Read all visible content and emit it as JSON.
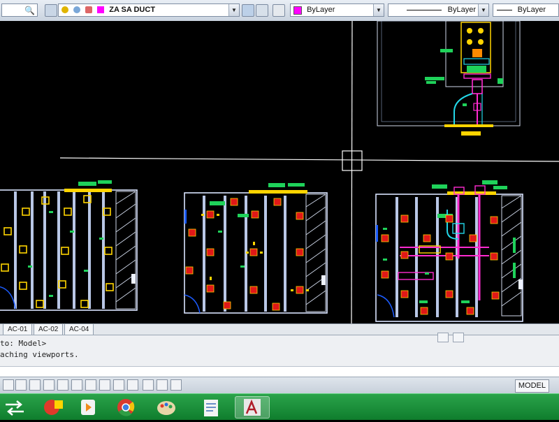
{
  "toolbar": {
    "layer_name": "ZA SA DUCT",
    "color_value": "ByLayer",
    "linetype_value": "ByLayer",
    "lineweight_value": "ByLayer",
    "icons": [
      "search-icon",
      "layer-icon",
      "layer-state-icon",
      "match-layer-icon",
      "color-icon",
      "linetype-icon",
      "lineweight-icon"
    ]
  },
  "layout_tabs": [
    "AC-01",
    "AC-02",
    "AC-04"
  ],
  "command": {
    "history_1": "to: Model>",
    "history_2": "aching viewports."
  },
  "status": {
    "model_label": "MODEL",
    "toggles": [
      "snap",
      "grid",
      "ortho",
      "polar",
      "osnap",
      "otrack",
      "ducs",
      "dyn",
      "lwt",
      "qp",
      "sc",
      "am"
    ]
  },
  "taskbar": {
    "apps": [
      "switch-icon",
      "media-icon",
      "player-icon",
      "chrome-icon",
      "paint-icon",
      "document-icon",
      "autocad-icon"
    ]
  },
  "colors": {
    "canvas": "#000000",
    "wall": "#d9e4ff",
    "duct_yellow": "#ffd400",
    "tag_green": "#1fd25a",
    "diffuser_red": "#e01818",
    "magenta": "#ff2bd0",
    "cyan": "#23d7e8",
    "blue": "#1c5cff",
    "crosshair": "#ffffff",
    "taskbar": "#1a8c3a"
  }
}
